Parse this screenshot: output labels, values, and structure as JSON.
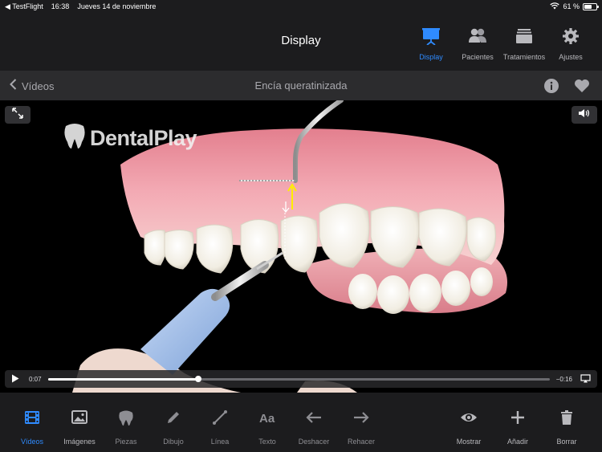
{
  "status_bar": {
    "app": "◀ TestFlight",
    "time": "16:38",
    "date": "Jueves 14 de noviembre",
    "battery_text": "61 %",
    "battery_level": 0.61
  },
  "top_nav": {
    "title": "Display",
    "tabs": [
      {
        "label": "Display",
        "icon": "presentation-icon",
        "active": true
      },
      {
        "label": "Pacientes",
        "icon": "people-icon",
        "active": false
      },
      {
        "label": "Tratamientos",
        "icon": "stack-icon",
        "active": false
      },
      {
        "label": "Ajustes",
        "icon": "gear-icon",
        "active": false
      }
    ]
  },
  "sub_nav": {
    "back_label": "Vídeos",
    "title": "Encía queratinizada",
    "actions": [
      "info-icon",
      "heart-icon"
    ]
  },
  "video": {
    "watermark": "DentalPlay",
    "elapsed": "0:07",
    "remaining": "−0:16",
    "progress": 0.3
  },
  "toolbar": {
    "items": [
      {
        "label": "Vídeos",
        "icon": "film-icon",
        "active": true
      },
      {
        "label": "Imágenes",
        "icon": "image-icon"
      },
      {
        "label": "Piezas",
        "icon": "tooth-icon"
      },
      {
        "label": "Dibujo",
        "icon": "pencil-icon"
      },
      {
        "label": "Línea",
        "icon": "line-icon"
      },
      {
        "label": "Texto",
        "icon": "text-icon"
      },
      {
        "label": "Deshacer",
        "icon": "arrow-left-icon"
      },
      {
        "label": "Rehacer",
        "icon": "arrow-right-icon"
      },
      {
        "label": "Mostrar",
        "icon": "eye-icon"
      },
      {
        "label": "Añadir",
        "icon": "plus-icon"
      },
      {
        "label": "Borrar",
        "icon": "trash-icon"
      }
    ]
  },
  "colors": {
    "accent": "#2f8bff",
    "bar_background": "#1c1c1e",
    "subbar_background": "#2c2c2e",
    "inactive": "#b9b9bd",
    "gum": "#f2a6b0",
    "tooth": "#f4f0e6",
    "marker": "#ffee00"
  }
}
